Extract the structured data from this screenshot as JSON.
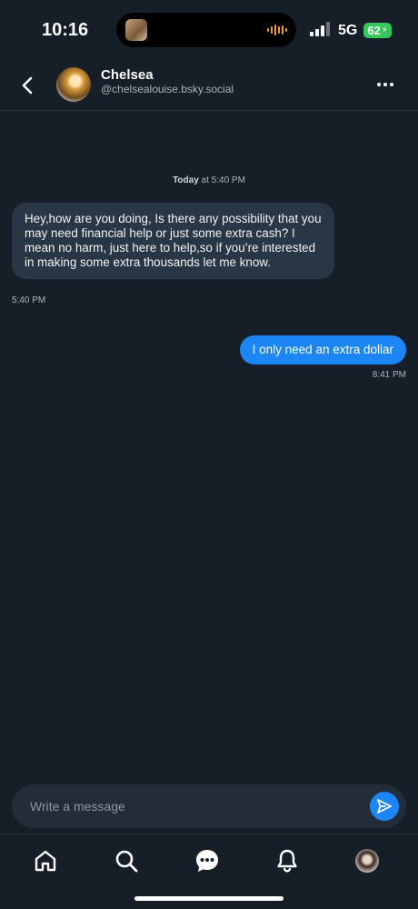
{
  "status_bar": {
    "time": "10:16",
    "network": "5G",
    "battery": "62"
  },
  "header": {
    "name": "Chelsea",
    "handle": "@chelsealouise.bsky.social"
  },
  "conversation": {
    "day_label": "Today",
    "day_time": " at 5:40 PM",
    "messages": [
      {
        "direction": "incoming",
        "text": "Hey,how are you doing, Is there any possibility that you may need financial help or just some extra cash? I mean no harm, just here to help,so if you’re interested in making some extra thousands let me know.",
        "time": "5:40 PM"
      },
      {
        "direction": "outgoing",
        "text": "I only need an extra dollar",
        "time": "8:41 PM"
      }
    ]
  },
  "composer": {
    "placeholder": "Write a message",
    "value": ""
  },
  "nav": {
    "items": [
      "home-icon",
      "search-icon",
      "chat-icon",
      "bell-icon",
      "profile-avatar"
    ]
  },
  "colors": {
    "background": "#161e27",
    "incoming_bubble": "#293645",
    "outgoing_bubble": "#1d86f6",
    "accent": "#1d86f6"
  }
}
